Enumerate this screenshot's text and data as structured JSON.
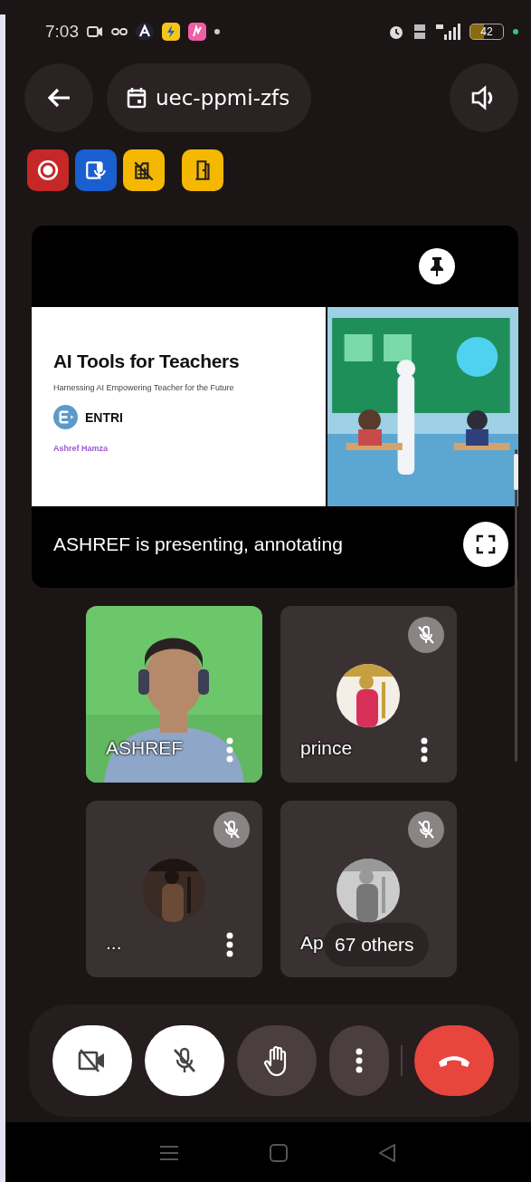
{
  "status_bar": {
    "time": "7:03",
    "battery": "42"
  },
  "header": {
    "meeting_code": "uec-ppmi-zfs"
  },
  "quick_actions": [
    {
      "kind": "record"
    },
    {
      "kind": "transcript"
    },
    {
      "kind": "effects"
    },
    {
      "kind": "rooms"
    }
  ],
  "presentation": {
    "slide": {
      "title": "AI Tools for Teachers",
      "subtitle": "Harnessing AI Empowering Teacher for the Future",
      "brand": "ENTRI",
      "author": "Ashref Hamza"
    },
    "caption": "ASHREF is presenting, annotating"
  },
  "participants": [
    {
      "name": "ASHREF",
      "kind": "video",
      "muted": false
    },
    {
      "name": "prince",
      "kind": "avatar",
      "muted": true
    },
    {
      "name": "...",
      "kind": "avatar",
      "muted": true
    },
    {
      "name": "Ap",
      "kind": "avatar",
      "muted": true,
      "overflow": "67 others"
    }
  ],
  "controls": [
    {
      "kind": "camera",
      "on": false
    },
    {
      "kind": "mic",
      "on": false
    },
    {
      "kind": "hand"
    },
    {
      "kind": "more"
    },
    {
      "kind": "end"
    }
  ]
}
